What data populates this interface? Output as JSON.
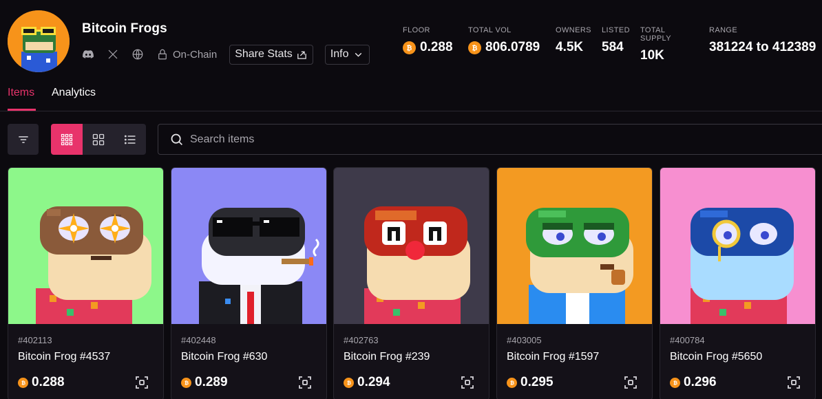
{
  "collection": {
    "name": "Bitcoin Frogs",
    "onchain_label": "On-Chain",
    "share_label": "Share Stats",
    "info_label": "Info"
  },
  "stats": [
    {
      "label": "FLOOR",
      "value": "0.288",
      "btc": true
    },
    {
      "label": "TOTAL VOL",
      "value": "806.0789",
      "btc": true
    },
    {
      "label": "OWNERS",
      "value": "4.5K",
      "btc": false
    },
    {
      "label": "LISTED",
      "value": "584",
      "btc": false
    },
    {
      "label": "TOTAL SUPPLY",
      "value": "10K",
      "btc": false
    },
    {
      "label": "RANGE",
      "value": "381224 to 412389",
      "btc": false
    }
  ],
  "tabs": [
    {
      "label": "Items",
      "active": true
    },
    {
      "label": "Analytics",
      "active": false
    }
  ],
  "search": {
    "placeholder": "Search items"
  },
  "icons": {
    "discord": "discord-icon",
    "x": "x-icon",
    "globe": "globe-icon",
    "lock": "lock-icon",
    "share": "share-icon",
    "chevron": "chevron-down-icon",
    "filter": "filter-icon",
    "grid_small": "grid-small-icon",
    "grid_large": "grid-large-icon",
    "list": "list-icon",
    "search": "search-icon",
    "bitcoin": "bitcoin-icon",
    "scan": "scan-icon"
  },
  "colors": {
    "accent": "#e8336b",
    "bitcoin": "#f7931a",
    "background": "#0c0a0f"
  },
  "items": [
    {
      "inscription": "#402113",
      "name": "Bitcoin Frog #4537",
      "price": "0.288",
      "bg": "#8df78a"
    },
    {
      "inscription": "#402448",
      "name": "Bitcoin Frog #630",
      "price": "0.289",
      "bg": "#8b88f5"
    },
    {
      "inscription": "#402763",
      "name": "Bitcoin Frog #239",
      "price": "0.294",
      "bg": "#3e3a4a"
    },
    {
      "inscription": "#403005",
      "name": "Bitcoin Frog #1597",
      "price": "0.295",
      "bg": "#f39a22"
    },
    {
      "inscription": "#400784",
      "name": "Bitcoin Frog #5650",
      "price": "0.296",
      "bg": "#f78fd0"
    }
  ]
}
